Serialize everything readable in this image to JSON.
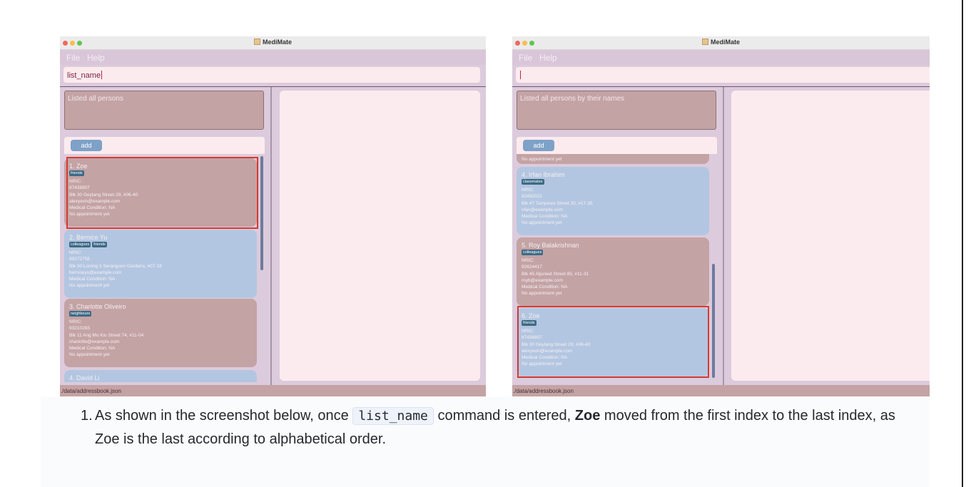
{
  "left_window": {
    "title": "MediMate",
    "menu": [
      "File",
      "Help"
    ],
    "command_value": "list_name",
    "result_text": "Listed all persons",
    "add_button": "add",
    "status_path": "./data/addressbook.json",
    "persons": [
      {
        "name": "1.  Zoe",
        "tags": [
          "friends"
        ],
        "nric": "NRIC:",
        "phone": "87438807",
        "address": "Blk 30 Geylang Street 29, #06-40",
        "email": "alexyeoh@example.com",
        "medical": "Medical Condition: NA",
        "appointment": "No appointment yet"
      },
      {
        "name": "2.  Bernice Yu",
        "tags": [
          "colleagues",
          "friends"
        ],
        "nric": "NRIC:",
        "phone": "99272758",
        "address": "Blk 30 Lorong 3 Serangoon Gardens, #07-18",
        "email": "berniceyu@example.com",
        "medical": "Medical Condition: NA",
        "appointment": "No appointment yet"
      },
      {
        "name": "3.  Charlotte Oliveiro",
        "tags": [
          "neighbours"
        ],
        "nric": "NRIC:",
        "phone": "93210283",
        "address": "Blk 11 Ang Mo Kio Street 74, #11-04",
        "email": "charlotte@example.com",
        "medical": "Medical Condition: NA",
        "appointment": "No appointment yet"
      },
      {
        "name": "4.  David Li",
        "tags": [],
        "nric": "",
        "phone": "",
        "address": "",
        "email": "",
        "medical": "",
        "appointment": ""
      }
    ]
  },
  "right_window": {
    "title": "MediMate",
    "menu": [
      "File",
      "Help"
    ],
    "command_value": "",
    "result_text": "Listed all persons by their names",
    "add_button": "add",
    "status_path": "./data/addressbook.json",
    "persons": [
      {
        "name": "",
        "tags": [],
        "nric": "",
        "phone": "",
        "address": "",
        "email": "",
        "medical": "",
        "appointment": "No appointment yet"
      },
      {
        "name": "4.  Irfan Ibrahim",
        "tags": [
          "classmates"
        ],
        "nric": "NRIC:",
        "phone": "92492021",
        "address": "Blk 47 Tampines Street 20, #17-35",
        "email": "irfan@example.com",
        "medical": "Medical Condition: NA",
        "appointment": "No appointment yet"
      },
      {
        "name": "5.  Roy Balakrishnan",
        "tags": [
          "colleagues"
        ],
        "nric": "NRIC:",
        "phone": "92624417",
        "address": "Blk 45 Aljunied Street 85, #11-31",
        "email": "royb@example.com",
        "medical": "Medical Condition: NA",
        "appointment": "No appointment yet"
      },
      {
        "name": "6.  Zoe",
        "tags": [
          "friends"
        ],
        "nric": "NRIC:",
        "phone": "87438807",
        "address": "Blk 30 Geylang Street 29, #06-40",
        "email": "alexyeoh@example.com",
        "medical": "Medical Condition: NA",
        "appointment": "No appointment yet"
      }
    ]
  },
  "caption": {
    "number": "1.",
    "text_before": "As shown in the screenshot below, once",
    "code": "list_name",
    "text_middle": "command is entered,",
    "bold": "Zoe",
    "text_after": "moved from the first index to the last index, as Zoe is the last according to alphabetical order."
  },
  "colors": {
    "card_pink": "#c4a3a4",
    "card_blue": "#b3c6e1",
    "highlight": "#d73a2f",
    "tag": "#3d6a85"
  }
}
